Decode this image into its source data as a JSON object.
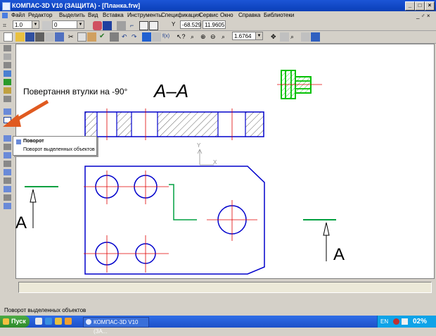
{
  "window": {
    "title": "КОМПАС-3D V10 (ЗАЩИТА) - [Планка.frw]"
  },
  "menu": {
    "items": [
      "Файл",
      "Редактор",
      "Выделить",
      "Вид",
      "Вставка",
      "Инструменты",
      "Спецификация",
      "Сервис",
      "Окно",
      "Справка",
      "Библиотеки"
    ],
    "mdi_controls": "_ ♂ ×"
  },
  "toolbar1": {
    "step_value": "1.0",
    "layer_value": "0",
    "x_label": "Y",
    "x_value": "-68.529",
    "y_value": "11.9605"
  },
  "toolbar2": {
    "zoom_value": "1.6764"
  },
  "drawing": {
    "annotation": "Повертання втулки на -90°",
    "section_title": "A–A",
    "cut_label_left": "A",
    "cut_label_right": "A",
    "axis_y": "Y",
    "axis_x": "X"
  },
  "popup": {
    "title": "Поворот",
    "description": "Поворот выделенных объектов"
  },
  "statusbar": {
    "text": "Поворот выделенных объектов"
  },
  "taskbar": {
    "start_label": "Пуск",
    "task_label": "КОМПАС-3D V10 (ЗА...",
    "lang": "EN",
    "clock": "02%"
  },
  "colors": {
    "titlebar": "#0a3fb8",
    "outline": "#0000cc",
    "centerline": "#e00000",
    "green": "#00c000",
    "arrow": "#e05a20"
  }
}
